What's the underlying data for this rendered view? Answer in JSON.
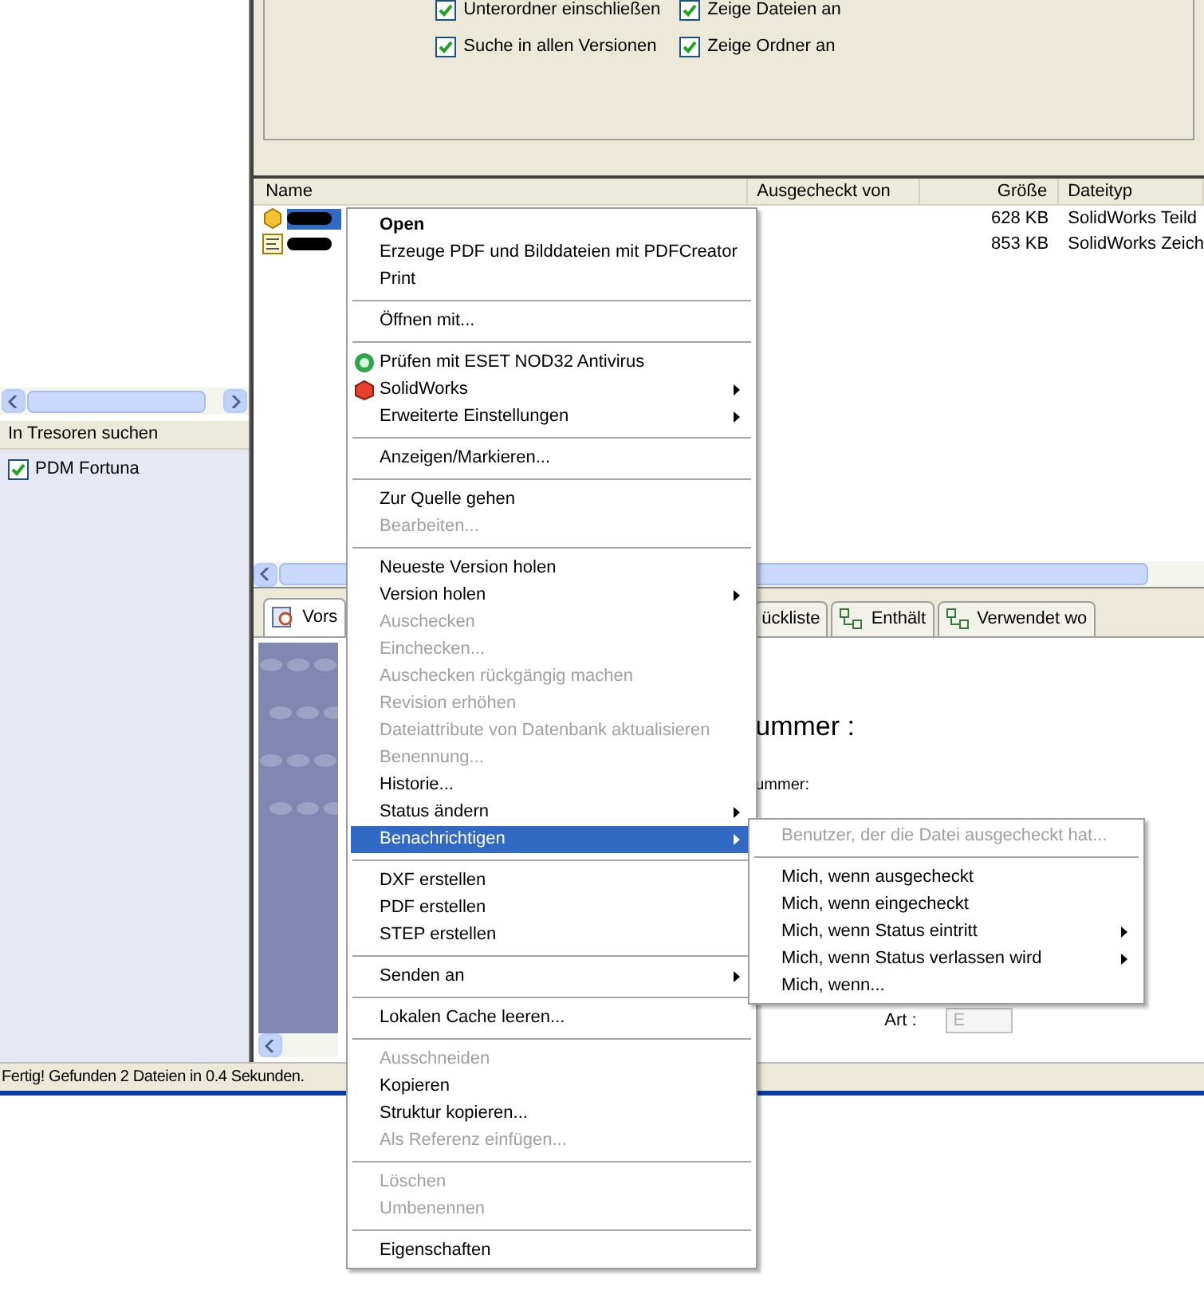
{
  "search_options": [
    {
      "label": "Unterordner einschließen",
      "checked": true
    },
    {
      "label": "Zeige Dateien an",
      "checked": true
    },
    {
      "label": "Suche in allen Versionen",
      "checked": true
    },
    {
      "label": "Zeige Ordner an",
      "checked": true
    }
  ],
  "vault_panel": {
    "header": "In Tresoren suchen",
    "vaults": [
      {
        "label": "PDM Fortuna",
        "checked": true
      }
    ]
  },
  "file_list": {
    "columns": [
      "Name",
      "Ausgecheckt von",
      "Größe",
      "Dateityp"
    ],
    "rows": [
      {
        "kind": "part",
        "size": "628 KB",
        "type": "SolidWorks Teild",
        "selected": true
      },
      {
        "kind": "drawing",
        "size": "853 KB",
        "type": "SolidWorks Zeich",
        "selected": false
      }
    ]
  },
  "tabs": [
    {
      "kind": "preview",
      "label": "Vors",
      "selected": true
    },
    {
      "kind": "plain",
      "label": "ückliste",
      "selected": false
    },
    {
      "kind": "tree",
      "label": "Enthält",
      "selected": false
    },
    {
      "kind": "tree",
      "label": "Verwendet wo",
      "selected": false
    }
  ],
  "preview_form": {
    "heading": "ummer :",
    "field_label": "ummer:",
    "type_label": "Art :",
    "type_value": "E"
  },
  "status_bar": "Fertig! Gefunden 2 Dateien in 0.4 Sekunden.",
  "context_menu": [
    {
      "kind": "item",
      "label": "Open",
      "default": true,
      "disabled": false,
      "submenu": false,
      "selected": false
    },
    {
      "kind": "item",
      "label": "Erzeuge PDF und Bilddateien mit PDFCreator",
      "default": false,
      "disabled": false,
      "submenu": false,
      "selected": false
    },
    {
      "kind": "item",
      "label": "Print",
      "default": false,
      "disabled": false,
      "submenu": false,
      "selected": false
    },
    {
      "kind": "separator"
    },
    {
      "kind": "item",
      "label": "Öffnen mit...",
      "default": false,
      "disabled": false,
      "submenu": false,
      "selected": false
    },
    {
      "kind": "separator"
    },
    {
      "kind": "scan",
      "label": "Prüfen mit ESET NOD32 Antivirus",
      "default": false,
      "disabled": false,
      "submenu": false,
      "selected": false
    },
    {
      "kind": "app",
      "label": "SolidWorks",
      "default": false,
      "disabled": false,
      "submenu": true,
      "selected": false
    },
    {
      "kind": "item",
      "label": "Erweiterte Einstellungen",
      "default": false,
      "disabled": false,
      "submenu": true,
      "selected": false
    },
    {
      "kind": "separator"
    },
    {
      "kind": "item",
      "label": "Anzeigen/Markieren...",
      "default": false,
      "disabled": false,
      "submenu": false,
      "selected": false
    },
    {
      "kind": "separator"
    },
    {
      "kind": "item",
      "label": "Zur Quelle gehen",
      "default": false,
      "disabled": false,
      "submenu": false,
      "selected": false
    },
    {
      "kind": "item",
      "label": "Bearbeiten...",
      "default": false,
      "disabled": true,
      "submenu": false,
      "selected": false
    },
    {
      "kind": "separator"
    },
    {
      "kind": "item",
      "label": "Neueste Version holen",
      "default": false,
      "disabled": false,
      "submenu": false,
      "selected": false
    },
    {
      "kind": "item",
      "label": "Version holen",
      "default": false,
      "disabled": false,
      "submenu": true,
      "selected": false
    },
    {
      "kind": "item",
      "label": "Auschecken",
      "default": false,
      "disabled": true,
      "submenu": false,
      "selected": false
    },
    {
      "kind": "item",
      "label": "Einchecken...",
      "default": false,
      "disabled": true,
      "submenu": false,
      "selected": false
    },
    {
      "kind": "item",
      "label": "Auschecken rückgängig machen",
      "default": false,
      "disabled": true,
      "submenu": false,
      "selected": false
    },
    {
      "kind": "item",
      "label": "Revision erhöhen",
      "default": false,
      "disabled": true,
      "submenu": false,
      "selected": false
    },
    {
      "kind": "item",
      "label": "Dateiattribute von Datenbank aktualisieren",
      "default": false,
      "disabled": true,
      "submenu": false,
      "selected": false
    },
    {
      "kind": "item",
      "label": "Benennung...",
      "default": false,
      "disabled": true,
      "submenu": false,
      "selected": false
    },
    {
      "kind": "item",
      "label": "Historie...",
      "default": false,
      "disabled": false,
      "submenu": false,
      "selected": false
    },
    {
      "kind": "item",
      "label": "Status ändern",
      "default": false,
      "disabled": false,
      "submenu": true,
      "selected": false
    },
    {
      "kind": "item",
      "label": "Benachrichtigen",
      "default": false,
      "disabled": false,
      "submenu": true,
      "selected": true
    },
    {
      "kind": "separator"
    },
    {
      "kind": "item",
      "label": "DXF erstellen",
      "default": false,
      "disabled": false,
      "submenu": false,
      "selected": false
    },
    {
      "kind": "item",
      "label": "PDF erstellen",
      "default": false,
      "disabled": false,
      "submenu": false,
      "selected": false
    },
    {
      "kind": "item",
      "label": "STEP erstellen",
      "default": false,
      "disabled": false,
      "submenu": false,
      "selected": false
    },
    {
      "kind": "separator"
    },
    {
      "kind": "item",
      "label": "Senden an",
      "default": false,
      "disabled": false,
      "submenu": true,
      "selected": false
    },
    {
      "kind": "separator"
    },
    {
      "kind": "item",
      "label": "Lokalen Cache leeren...",
      "default": false,
      "disabled": false,
      "submenu": false,
      "selected": false
    },
    {
      "kind": "separator"
    },
    {
      "kind": "item",
      "label": "Ausschneiden",
      "default": false,
      "disabled": true,
      "submenu": false,
      "selected": false
    },
    {
      "kind": "item",
      "label": "Kopieren",
      "default": false,
      "disabled": false,
      "submenu": false,
      "selected": false
    },
    {
      "kind": "item",
      "label": "Struktur kopieren...",
      "default": false,
      "disabled": false,
      "submenu": false,
      "selected": false
    },
    {
      "kind": "item",
      "label": "Als Referenz einfügen...",
      "default": false,
      "disabled": true,
      "submenu": false,
      "selected": false
    },
    {
      "kind": "separator"
    },
    {
      "kind": "item",
      "label": "Löschen",
      "default": false,
      "disabled": true,
      "submenu": false,
      "selected": false
    },
    {
      "kind": "item",
      "label": "Umbenennen",
      "default": false,
      "disabled": true,
      "submenu": false,
      "selected": false
    },
    {
      "kind": "separator"
    },
    {
      "kind": "item",
      "label": "Eigenschaften",
      "default": false,
      "disabled": false,
      "submenu": false,
      "selected": false
    }
  ],
  "submenu": [
    {
      "kind": "item",
      "label": "Benutzer, der die Datei ausgecheckt hat...",
      "disabled": true,
      "submenu": false
    },
    {
      "kind": "separator"
    },
    {
      "kind": "item",
      "label": "Mich, wenn ausgecheckt",
      "disabled": false,
      "submenu": false
    },
    {
      "kind": "item",
      "label": "Mich, wenn eingecheckt",
      "disabled": false,
      "submenu": false
    },
    {
      "kind": "item",
      "label": "Mich, wenn Status eintritt",
      "disabled": false,
      "submenu": true
    },
    {
      "kind": "item",
      "label": "Mich, wenn Status verlassen wird",
      "disabled": false,
      "submenu": true
    },
    {
      "kind": "item",
      "label": "Mich, wenn...",
      "disabled": false,
      "submenu": false
    }
  ]
}
